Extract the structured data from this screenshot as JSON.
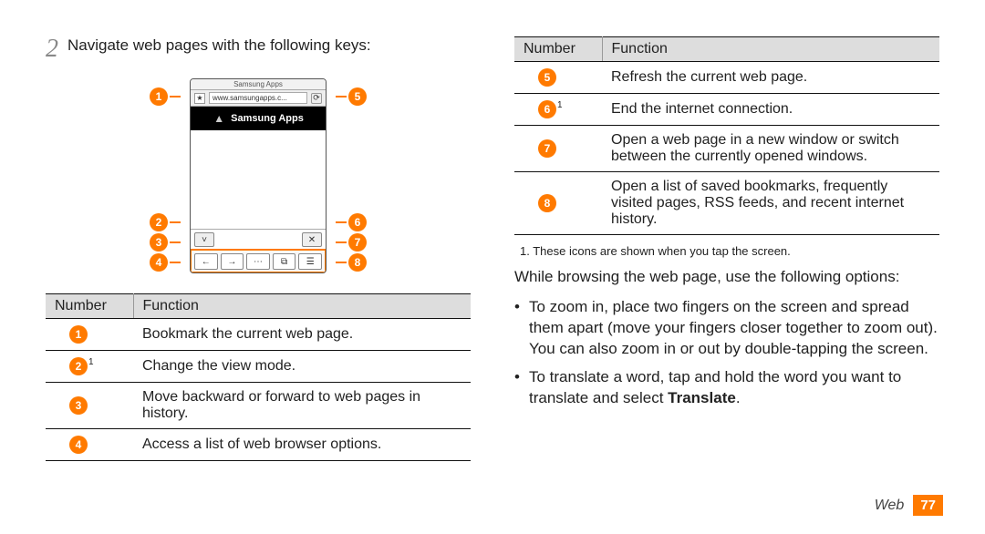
{
  "left": {
    "step_number": "2",
    "step_text": "Navigate web pages with the following keys:",
    "phone": {
      "header": "Samsung Apps",
      "address": "www.samsungapps.c...",
      "banner": "Samsung Apps"
    },
    "callouts_left": [
      "1",
      "2",
      "3",
      "4"
    ],
    "callouts_right": [
      "5",
      "6",
      "7",
      "8"
    ],
    "table_headers": [
      "Number",
      "Function"
    ],
    "rows": [
      {
        "n": "1",
        "f": "Bookmark the current web page."
      },
      {
        "n": "2",
        "sup": "1",
        "f": "Change the view mode."
      },
      {
        "n": "3",
        "f": "Move backward or forward to web pages in history."
      },
      {
        "n": "4",
        "f": "Access a list of web browser options."
      }
    ]
  },
  "right": {
    "table_headers": [
      "Number",
      "Function"
    ],
    "rows": [
      {
        "n": "5",
        "f": "Refresh the current web page."
      },
      {
        "n": "6",
        "sup": "1",
        "f": "End the internet connection."
      },
      {
        "n": "7",
        "f": "Open a web page in a new window or switch between the currently opened windows."
      },
      {
        "n": "8",
        "f": "Open a list of saved bookmarks, frequently visited pages, RSS feeds, and recent internet history."
      }
    ],
    "footnote": "1. These icons are shown when you tap the screen.",
    "body_intro": "While browsing the web page, use the following options:",
    "bullets": [
      "To zoom in, place two fingers on the screen and spread them apart (move your fingers closer together to zoom out). You can also zoom in or out by double-tapping the screen.",
      "To translate a word, tap and hold the word you want to translate and select "
    ],
    "translate_word": "Translate",
    "translate_suffix": "."
  },
  "footer": {
    "section": "Web",
    "page": "77"
  }
}
